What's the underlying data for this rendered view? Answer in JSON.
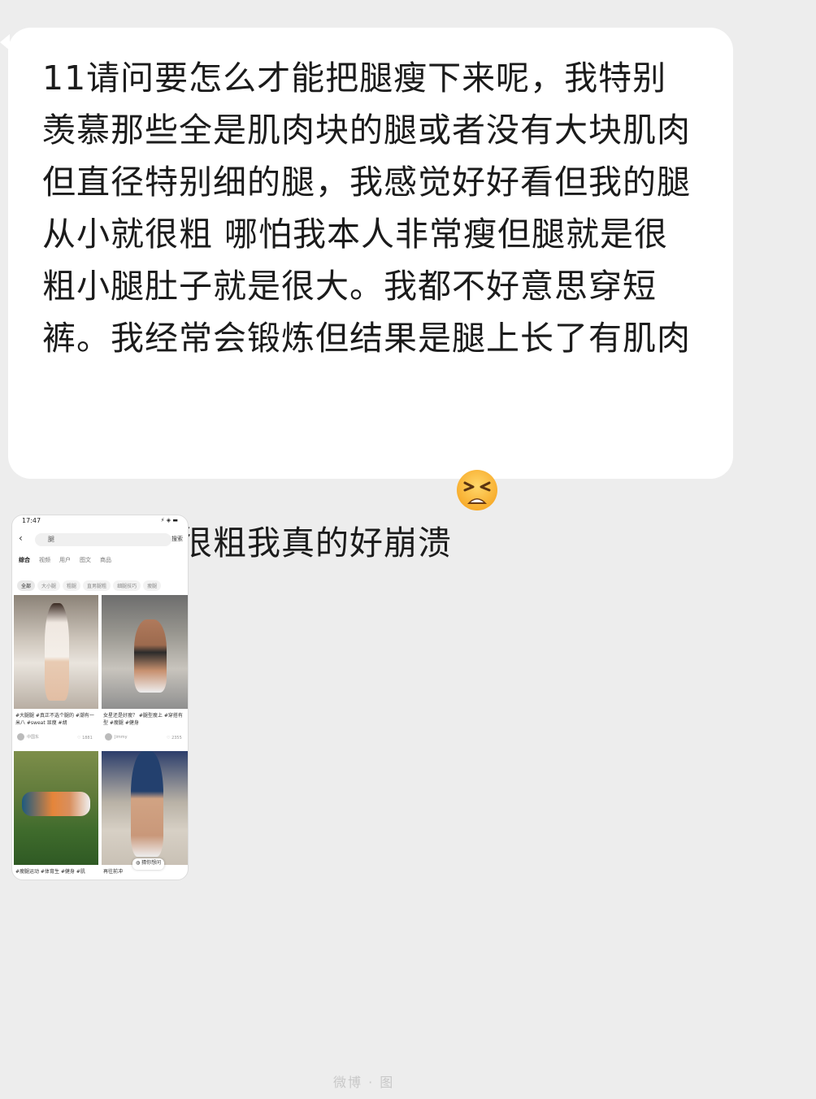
{
  "message": {
    "text": "11请问要怎么才能把腿瘦下来呢，我特别羡慕那些全是肌肉块的腿或者没有大块肌肉但直径特别细的腿，我感觉好好看但我的腿从小就很粗 哪怕我本人非常瘦但腿就是很粗小腿肚子就是很大。我都不好意思穿短裤。我经常会锻炼但结果是腿上长了有肌肉但也还是很粗我真的好崩溃",
    "emoji": "tired-face-emoji"
  },
  "screenshot": {
    "status_time": "17:47",
    "status_right": "⚡ ◈ ▬",
    "search_query": "腿",
    "search_button": "搜索",
    "back_label": "‹",
    "tabs": [
      "综合",
      "视频",
      "用户",
      "图文",
      "商品"
    ],
    "chips": [
      "全部",
      "大小腿",
      "粗腿",
      "直男腿粗",
      "细腿技巧",
      "瘦腿"
    ],
    "captions": {
      "a": "#大腿腿 #真正不选个腿的 #潮有一米八 #sweat 显瘦 #胡",
      "b": "女星还是好瘦？ #腿型瘦上 #穿搭有型 #瘦腿 #健身",
      "c": "#瘦腿运动 #体育生 #健身 #肌",
      "d": "再往前冲"
    },
    "users": {
      "a": "中国东",
      "b": "Jimmy"
    },
    "likes": {
      "a": "♡ 1881",
      "b": "♡ 2355"
    },
    "float_label": "◍ 猜你想问"
  },
  "watermark": "微博 · 图"
}
